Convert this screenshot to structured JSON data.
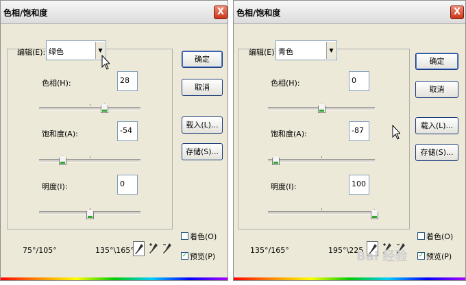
{
  "left_dialog": {
    "title": "色相/饱和度",
    "close_label": "X",
    "edit_label": "编辑(E):",
    "edit_value": "绿色",
    "hue_label": "色相(H):",
    "hue_value": "28",
    "saturation_label": "饱和度(A):",
    "saturation_value": "-54",
    "lightness_label": "明度(I):",
    "lightness_value": "0",
    "ok_label": "确定",
    "cancel_label": "取消",
    "load_label": "载入(L)...",
    "save_label": "存储(S)...",
    "range_left": "75°/105°",
    "range_right": "135°\\165°",
    "colorize_label": "着色(O)",
    "colorize_checked": false,
    "preview_label": "预览(P)",
    "preview_checked": true
  },
  "right_dialog": {
    "title": "色相/饱和度",
    "close_label": "X",
    "edit_label": "编辑(E):",
    "edit_value": "青色",
    "hue_label": "色相(H):",
    "hue_value": "0",
    "saturation_label": "饱和度(A):",
    "saturation_value": "-87",
    "lightness_label": "明度(I):",
    "lightness_value": "100",
    "ok_label": "确定",
    "cancel_label": "取消",
    "load_label": "载入(L)...",
    "save_label": "存储(S)...",
    "range_left": "135°/165°",
    "range_right": "195°\\225",
    "colorize_label": "着色(O)",
    "colorize_checked": false,
    "preview_label": "预览(P)",
    "preview_checked": true
  },
  "icons": {
    "dropdown_arrow": "chevron-down-icon",
    "eyedropper": "eyedropper-icon",
    "eyedropper_add": "eyedropper-plus-icon",
    "eyedropper_subtract": "eyedropper-minus-icon",
    "cursor": "mouse-pointer-icon"
  },
  "colors": {
    "dialog_bg": "#ece9d8",
    "close_red": "#c8371b",
    "slider_thumb_green": "#2fa62f"
  },
  "watermark": "Bai 经验"
}
